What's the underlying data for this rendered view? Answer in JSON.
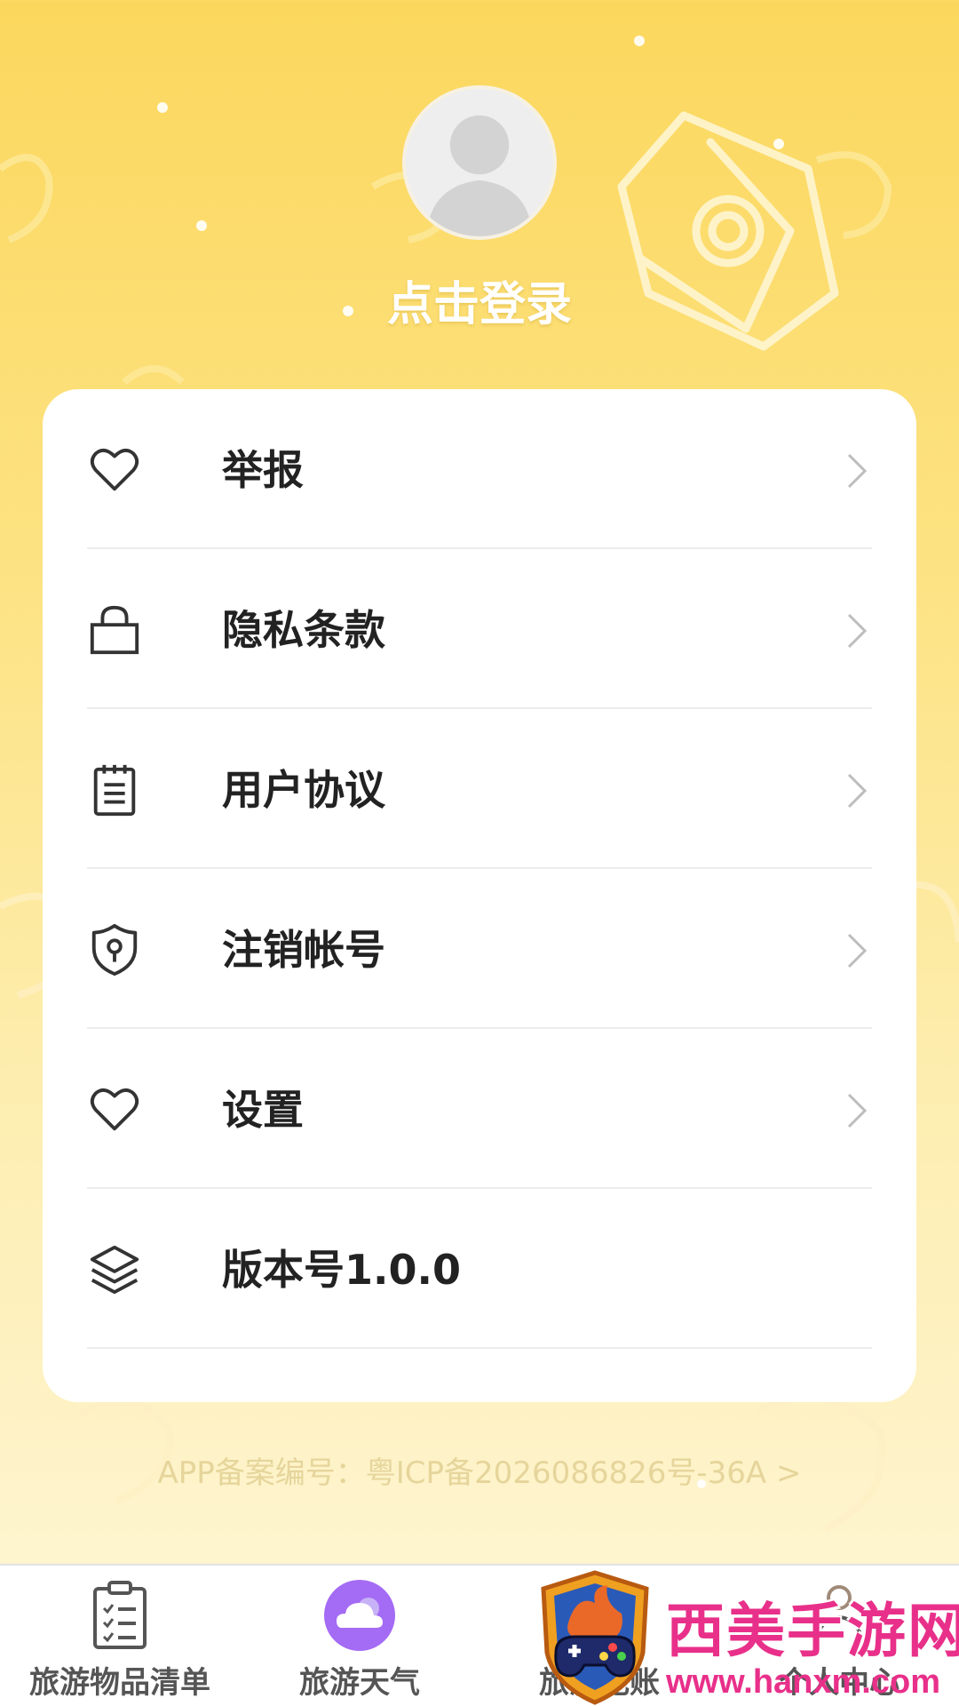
{
  "profile": {
    "login_text": "点击登录"
  },
  "menu": {
    "items": [
      {
        "label": "举报",
        "icon": "heart-icon"
      },
      {
        "label": "隐私条款",
        "icon": "lock-icon"
      },
      {
        "label": "用户协议",
        "icon": "notepad-icon"
      },
      {
        "label": "注销帐号",
        "icon": "shield-keyhole-icon"
      },
      {
        "label": "设置",
        "icon": "heart-icon"
      },
      {
        "label": "版本号1.0.0",
        "icon": "layers-icon"
      }
    ]
  },
  "footer": {
    "icp_text": "APP备案编号：粤ICP备2026086826号-36A >"
  },
  "tabbar": {
    "tabs": [
      {
        "label": "旅游物品清单",
        "icon": "checklist-icon"
      },
      {
        "label": "旅游天气",
        "icon": "cloud-weather-icon"
      },
      {
        "label": "旅游记账",
        "icon": "account-icon"
      },
      {
        "label": "个人中心",
        "icon": "profile-icon"
      }
    ]
  },
  "watermark": {
    "title": "西美手游网",
    "url": "www.hanxm.com"
  },
  "colors": {
    "background_top": "#fbd75d",
    "card": "#ffffff",
    "text_primary": "#222222",
    "icp_text": "#e6d59b",
    "tab_weather_accent": "#a46bf5",
    "watermark": "#e8308a"
  }
}
